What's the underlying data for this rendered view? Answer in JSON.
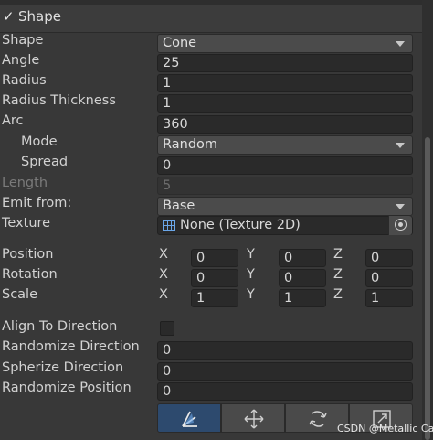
{
  "header": {
    "title": "Shape",
    "checked": true
  },
  "rows": {
    "shape": {
      "label": "Shape",
      "value": "Cone"
    },
    "angle": {
      "label": "Angle",
      "value": "25"
    },
    "radius": {
      "label": "Radius",
      "value": "1"
    },
    "radius_thickness": {
      "label": "Radius Thickness",
      "value": "1"
    },
    "arc": {
      "label": "Arc",
      "value": "360"
    },
    "mode": {
      "label": "Mode",
      "value": "Random"
    },
    "spread": {
      "label": "Spread",
      "value": "0"
    },
    "length": {
      "label": "Length",
      "value": "5"
    },
    "emit_from": {
      "label": "Emit from:",
      "value": "Base"
    },
    "texture": {
      "label": "Texture",
      "value": "None (Texture 2D)"
    }
  },
  "transform": {
    "axes": {
      "x": "X",
      "y": "Y",
      "z": "Z"
    },
    "position": {
      "label": "Position",
      "x": "0",
      "y": "0",
      "z": "0"
    },
    "rotation": {
      "label": "Rotation",
      "x": "0",
      "y": "0",
      "z": "0"
    },
    "scale": {
      "label": "Scale",
      "x": "1",
      "y": "1",
      "z": "1"
    }
  },
  "options": {
    "align_to_direction": {
      "label": "Align To Direction",
      "checked": false
    },
    "randomize_direction": {
      "label": "Randomize Direction",
      "value": "0"
    },
    "spherize_direction": {
      "label": "Spherize Direction",
      "value": "0"
    },
    "randomize_position": {
      "label": "Randomize Position",
      "value": "0"
    }
  },
  "toolbar": {
    "buttons": [
      "edit-shape-icon",
      "move-icon",
      "rotate-icon",
      "scale-icon"
    ]
  },
  "watermark": "CSDN @Metallic Cat"
}
